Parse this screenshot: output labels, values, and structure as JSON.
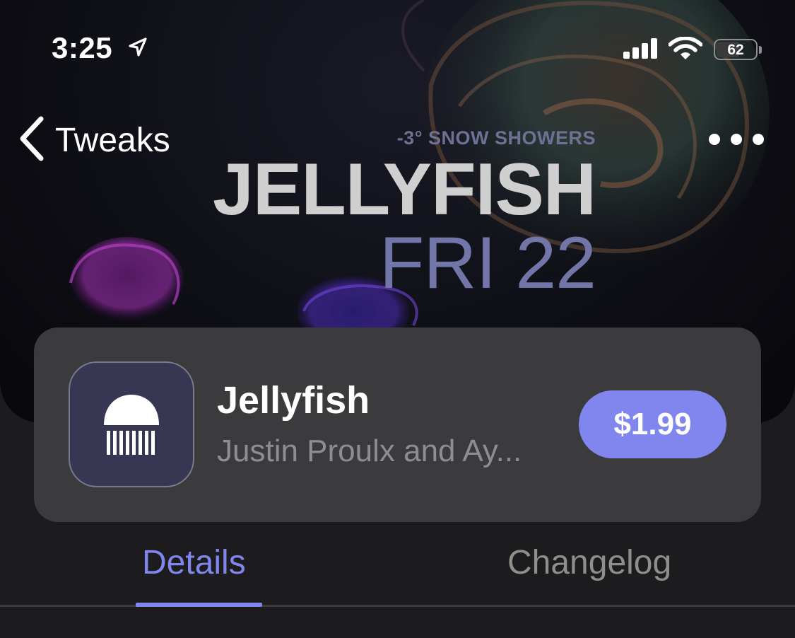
{
  "status_bar": {
    "time": "3:25",
    "battery_percent": "62",
    "battery_level_fraction": 0.62,
    "icons": [
      "location-arrow-icon",
      "cellular-signal-icon",
      "wifi-icon",
      "battery-icon"
    ]
  },
  "nav": {
    "back_label": "Tweaks",
    "back_icon": "chevron-left-icon",
    "more_icon": "ellipsis-icon"
  },
  "hero": {
    "weather": "-3° SNOW SHOWERS",
    "title": "JELLYFISH",
    "date": "FRI 22"
  },
  "app": {
    "name": "Jellyfish",
    "author": "Justin Proulx and Ay...",
    "price": "$1.99",
    "icon": "jellyfish-icon",
    "icon_bg_color": "#373754"
  },
  "tabs": [
    {
      "label": "Details",
      "active": true
    },
    {
      "label": "Changelog",
      "active": false
    }
  ],
  "colors": {
    "accent": "#8086ee",
    "card_bg": "#3b3b3d",
    "page_bg": "#1c1c1e",
    "inactive_tab": "#8e8e8a"
  }
}
